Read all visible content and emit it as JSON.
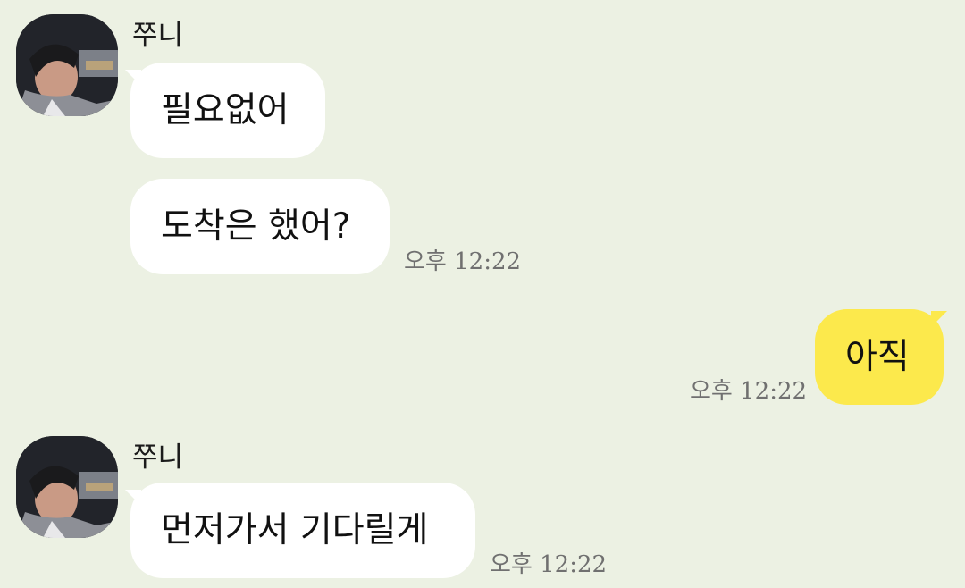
{
  "chat": {
    "colors": {
      "background": "#ecf1e3",
      "incoming_bubble": "#ffffff",
      "outgoing_bubble": "#fce94c",
      "timestamp": "#707070"
    },
    "groups": [
      {
        "sender": "쭈니",
        "avatar_icon": "profile-photo",
        "messages": [
          {
            "text": "필요없어"
          },
          {
            "text": "도착은 했어?",
            "time": "오후 12:22"
          }
        ]
      },
      {
        "outgoing": true,
        "messages": [
          {
            "text": "아직",
            "time": "오후 12:22"
          }
        ]
      },
      {
        "sender": "쭈니",
        "avatar_icon": "profile-photo",
        "messages": [
          {
            "text": "먼저가서 기다릴게",
            "time": "오후 12:22"
          }
        ]
      }
    ]
  }
}
